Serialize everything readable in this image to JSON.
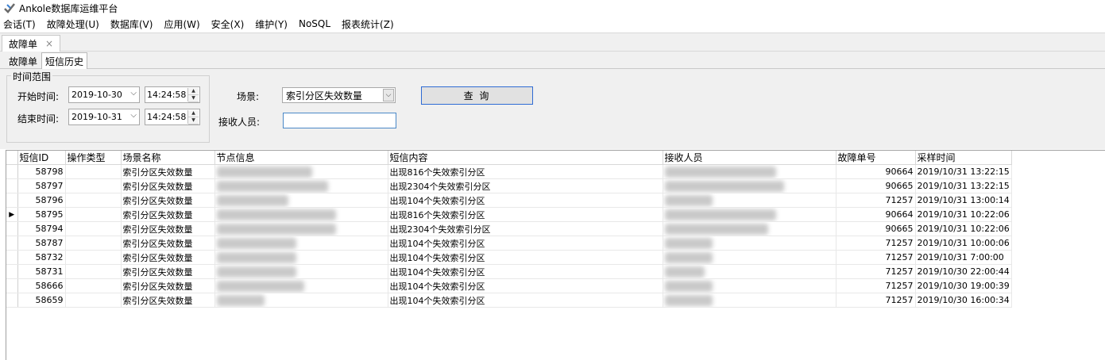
{
  "app": {
    "title": "Ankole数据库运维平台"
  },
  "menu": [
    "会话(T)",
    "故障处理(U)",
    "数据库(V)",
    "应用(W)",
    "安全(X)",
    "维护(Y)",
    "NoSQL",
    "报表统计(Z)"
  ],
  "doc_tab": {
    "label": "故障单",
    "close": "×"
  },
  "sub_tabs": [
    "故障单",
    "短信历史"
  ],
  "filter": {
    "time_group_label": "时间范围",
    "start_label": "开始时间:",
    "start_date": "2019-10-30",
    "start_time": "14:24:58",
    "end_label": "结束时间:",
    "end_date": "2019-10-31",
    "end_time": "14:24:58",
    "scene_label": "场景:",
    "scene_value": "索引分区失效数量",
    "receiver_label": "接收人员:",
    "receiver_value": "",
    "query_button": "查 询"
  },
  "grid": {
    "columns": [
      "短信ID",
      "操作类型",
      "场景名称",
      "节点信息",
      "短信内容",
      "接收人员",
      "故障单号",
      "采样时间"
    ],
    "current_row_index": 3,
    "rows": [
      {
        "id": "58798",
        "op": "",
        "scene": "索引分区失效数量",
        "node": "",
        "content": "出现816个失效索引分区",
        "receiver": "",
        "ticket": "90664",
        "time": "2019/10/31 13:22:15"
      },
      {
        "id": "58797",
        "op": "",
        "scene": "索引分区失效数量",
        "node": "",
        "content": "出现2304个失效索引分区",
        "receiver": "",
        "ticket": "90665",
        "time": "2019/10/31 13:22:15"
      },
      {
        "id": "58796",
        "op": "",
        "scene": "索引分区失效数量",
        "node": "",
        "content": "出现104个失效索引分区",
        "receiver": "",
        "ticket": "71257",
        "time": "2019/10/31 13:00:14"
      },
      {
        "id": "58795",
        "op": "",
        "scene": "索引分区失效数量",
        "node": "",
        "content": "出现816个失效索引分区",
        "receiver": "",
        "ticket": "90664",
        "time": "2019/10/31 10:22:06"
      },
      {
        "id": "58794",
        "op": "",
        "scene": "索引分区失效数量",
        "node": "",
        "content": "出现2304个失效索引分区",
        "receiver": "",
        "ticket": "90665",
        "time": "2019/10/31 10:22:06"
      },
      {
        "id": "58787",
        "op": "",
        "scene": "索引分区失效数量",
        "node": "",
        "content": "出现104个失效索引分区",
        "receiver": "",
        "ticket": "71257",
        "time": "2019/10/31 10:00:06"
      },
      {
        "id": "58732",
        "op": "",
        "scene": "索引分区失效数量",
        "node": "",
        "content": "出现104个失效索引分区",
        "receiver": "",
        "ticket": "71257",
        "time": "2019/10/31 7:00:00"
      },
      {
        "id": "58731",
        "op": "",
        "scene": "索引分区失效数量",
        "node": "",
        "content": "出现104个失效索引分区",
        "receiver": "",
        "ticket": "71257",
        "time": "2019/10/30 22:00:44"
      },
      {
        "id": "58666",
        "op": "",
        "scene": "索引分区失效数量",
        "node": "",
        "content": "出现104个失效索引分区",
        "receiver": "",
        "ticket": "71257",
        "time": "2019/10/30 19:00:39"
      },
      {
        "id": "58659",
        "op": "",
        "scene": "索引分区失效数量",
        "node": "",
        "content": "出现104个失效索引分区",
        "receiver": "",
        "ticket": "71257",
        "time": "2019/10/30 16:00:34"
      }
    ]
  }
}
